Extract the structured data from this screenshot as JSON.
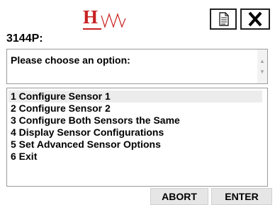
{
  "header": {
    "logo_text": "H",
    "logo_color": "#c82020",
    "doc_icon": "document-icon",
    "close_icon": "close-icon"
  },
  "device": {
    "label": "3144P:"
  },
  "prompt": {
    "text": "Please choose an option:"
  },
  "menu": {
    "selected_index": 0,
    "items": [
      {
        "label": "1 Configure Sensor 1"
      },
      {
        "label": "2 Configure Sensor 2"
      },
      {
        "label": "3 Configure Both Sensors the Same"
      },
      {
        "label": "4 Display Sensor Configurations"
      },
      {
        "label": "5 Set Advanced Sensor Options"
      },
      {
        "label": "6 Exit"
      }
    ]
  },
  "buttons": {
    "abort_label": "ABORT",
    "enter_label": "ENTER"
  }
}
